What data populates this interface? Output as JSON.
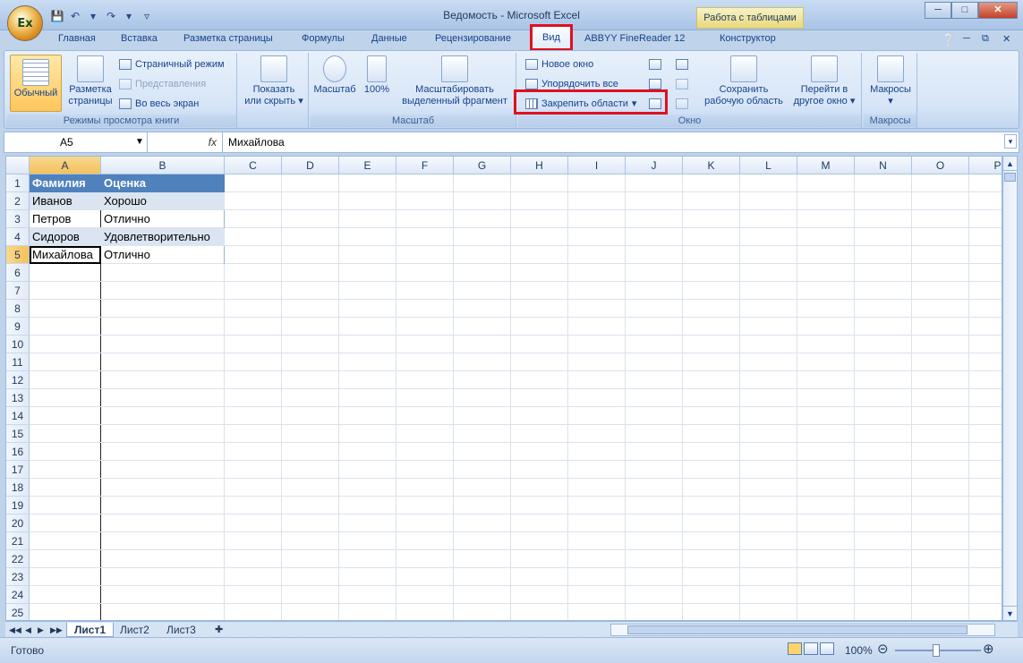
{
  "window": {
    "title": "Ведомость - Microsoft Excel",
    "context_tab_header": "Работа с таблицами",
    "office_button_glyph": "Ex"
  },
  "tabs": [
    "Главная",
    "Вставка",
    "Разметка страницы",
    "Формулы",
    "Данные",
    "Рецензирование",
    "Вид",
    "ABBYY FineReader 12",
    "Конструктор"
  ],
  "ribbon": {
    "group_views": {
      "label": "Режимы просмотра книги",
      "normal": "Обычный",
      "page_layout_line1": "Разметка",
      "page_layout_line2": "страницы",
      "page_mode": "Страничный режим",
      "custom_views": "Представления",
      "full_screen": "Во весь экран"
    },
    "group_show": {
      "line1": "Показать",
      "line2": "или скрыть"
    },
    "group_zoom": {
      "label": "Масштаб",
      "zoom": "Масштаб",
      "zoom100": "100%",
      "zoom_sel_line1": "Масштабировать",
      "zoom_sel_line2": "выделенный фрагмент"
    },
    "group_window": {
      "label": "Окно",
      "new_window": "Новое окно",
      "arrange_all": "Упорядочить все",
      "freeze_panes": "Закрепить области",
      "save_ws_line1": "Сохранить",
      "save_ws_line2": "рабочую область",
      "switch_line1": "Перейти в",
      "switch_line2": "другое окно"
    },
    "group_macros": {
      "label": "Макросы",
      "macros": "Макросы"
    }
  },
  "formula_bar": {
    "name_box": "A5",
    "fx": "fx",
    "value": "Михайлова"
  },
  "columns": [
    "A",
    "B",
    "C",
    "D",
    "E",
    "F",
    "G",
    "H",
    "I",
    "J",
    "K",
    "L",
    "M",
    "N",
    "O",
    "P"
  ],
  "rows": [
    "1",
    "2",
    "3",
    "4",
    "5",
    "6",
    "7",
    "8",
    "9",
    "10",
    "11",
    "12",
    "13",
    "14",
    "15",
    "16",
    "17",
    "18",
    "19",
    "20",
    "21",
    "22",
    "23",
    "24",
    "25"
  ],
  "table": {
    "headers": [
      "Фамилия",
      "Оценка"
    ],
    "rows": [
      [
        "Иванов",
        "Хорошо"
      ],
      [
        "Петров",
        "Отлично"
      ],
      [
        "Сидоров",
        "Удовлетворительно"
      ],
      [
        "Михайлова",
        "Отлично"
      ]
    ],
    "header_color": "#4f81bd",
    "band_color": "#dbe5f1"
  },
  "sheets": [
    "Лист1",
    "Лист2",
    "Лист3"
  ],
  "status": {
    "ready": "Готово",
    "zoom": "100%"
  },
  "highlight_color": "#e01020"
}
